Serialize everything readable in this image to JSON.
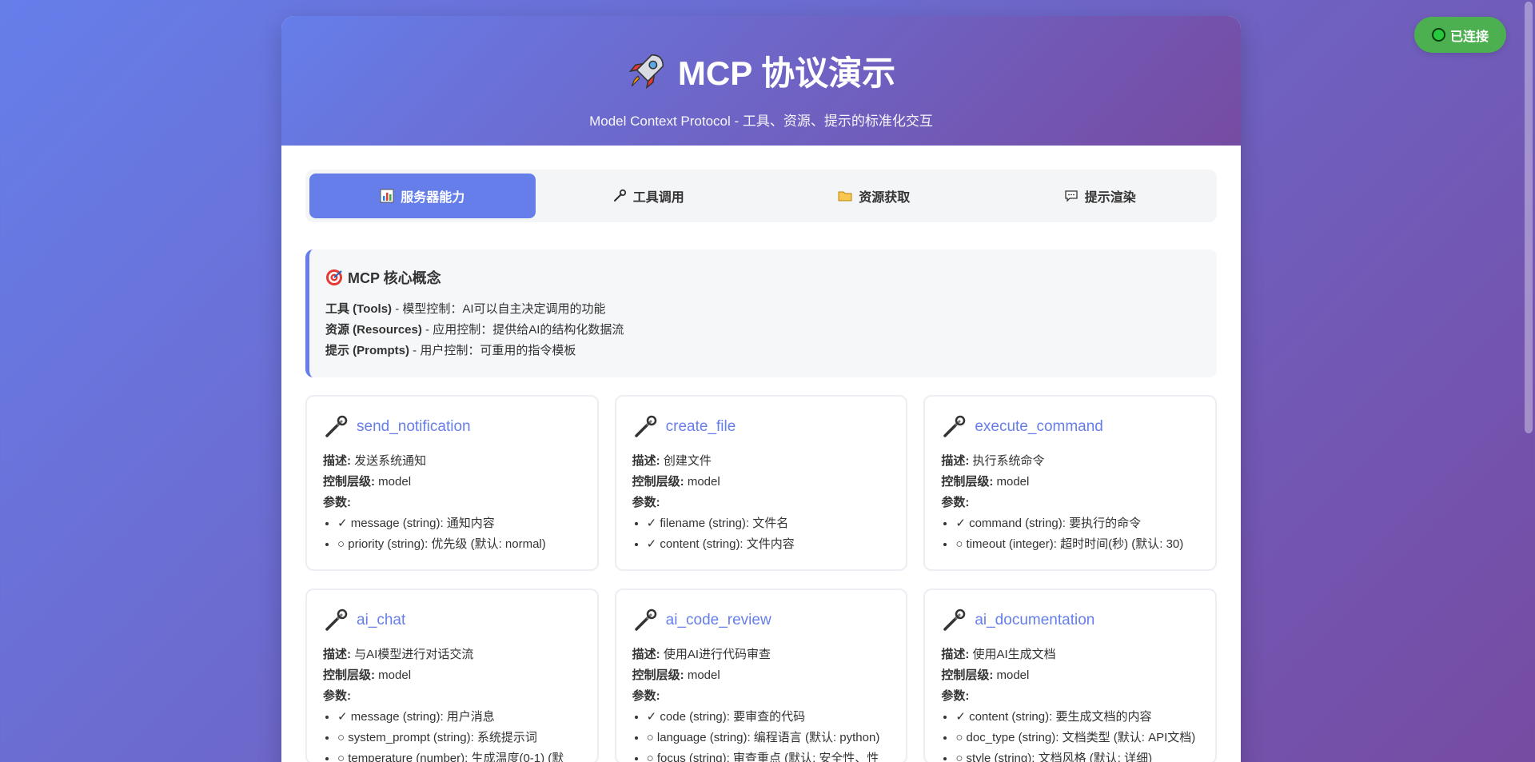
{
  "status": {
    "label": "已连接"
  },
  "header": {
    "title": "MCP 协议演示",
    "subtitle": "Model Context Protocol - 工具、资源、提示的标准化交互"
  },
  "tabs": [
    {
      "label": "服务器能力",
      "icon": "bar-chart-icon",
      "active": true
    },
    {
      "label": "工具调用",
      "icon": "wrench-icon",
      "active": false
    },
    {
      "label": "资源获取",
      "icon": "folder-icon",
      "active": false
    },
    {
      "label": "提示渲染",
      "icon": "speech-bubble-icon",
      "active": false
    }
  ],
  "concept": {
    "title": "MCP 核心概念",
    "items": [
      {
        "term": "工具 (Tools)",
        "desc": " - 模型控制：AI可以自主决定调用的功能"
      },
      {
        "term": "资源 (Resources)",
        "desc": " - 应用控制：提供给AI的结构化数据流"
      },
      {
        "term": "提示 (Prompts)",
        "desc": " - 用户控制：可重用的指令模板"
      }
    ]
  },
  "labels": {
    "description": "描述:",
    "control_level": "控制层级:",
    "params": "参数:"
  },
  "tools": [
    {
      "name": "send_notification",
      "description": "发送系统通知",
      "control": "model",
      "params": [
        "✓ message (string): 通知内容",
        "○ priority (string): 优先级 (默认: normal)"
      ]
    },
    {
      "name": "create_file",
      "description": "创建文件",
      "control": "model",
      "params": [
        "✓ filename (string): 文件名",
        "✓ content (string): 文件内容"
      ]
    },
    {
      "name": "execute_command",
      "description": "执行系统命令",
      "control": "model",
      "params": [
        "✓ command (string): 要执行的命令",
        "○ timeout (integer): 超时时间(秒) (默认: 30)"
      ]
    },
    {
      "name": "ai_chat",
      "description": "与AI模型进行对话交流",
      "control": "model",
      "params": [
        "✓ message (string): 用户消息",
        "○ system_prompt (string): 系统提示词",
        "○ temperature (number): 生成温度(0-1) (默"
      ]
    },
    {
      "name": "ai_code_review",
      "description": "使用AI进行代码审查",
      "control": "model",
      "params": [
        "✓ code (string): 要审查的代码",
        "○ language (string): 编程语言 (默认: python)",
        "○ focus (string): 审查重点 (默认: 安全性、性"
      ]
    },
    {
      "name": "ai_documentation",
      "description": "使用AI生成文档",
      "control": "model",
      "params": [
        "✓ content (string): 要生成文档的内容",
        "○ doc_type (string): 文档类型 (默认: API文档)",
        "○ style (string): 文档风格 (默认: 详细)"
      ]
    }
  ]
}
